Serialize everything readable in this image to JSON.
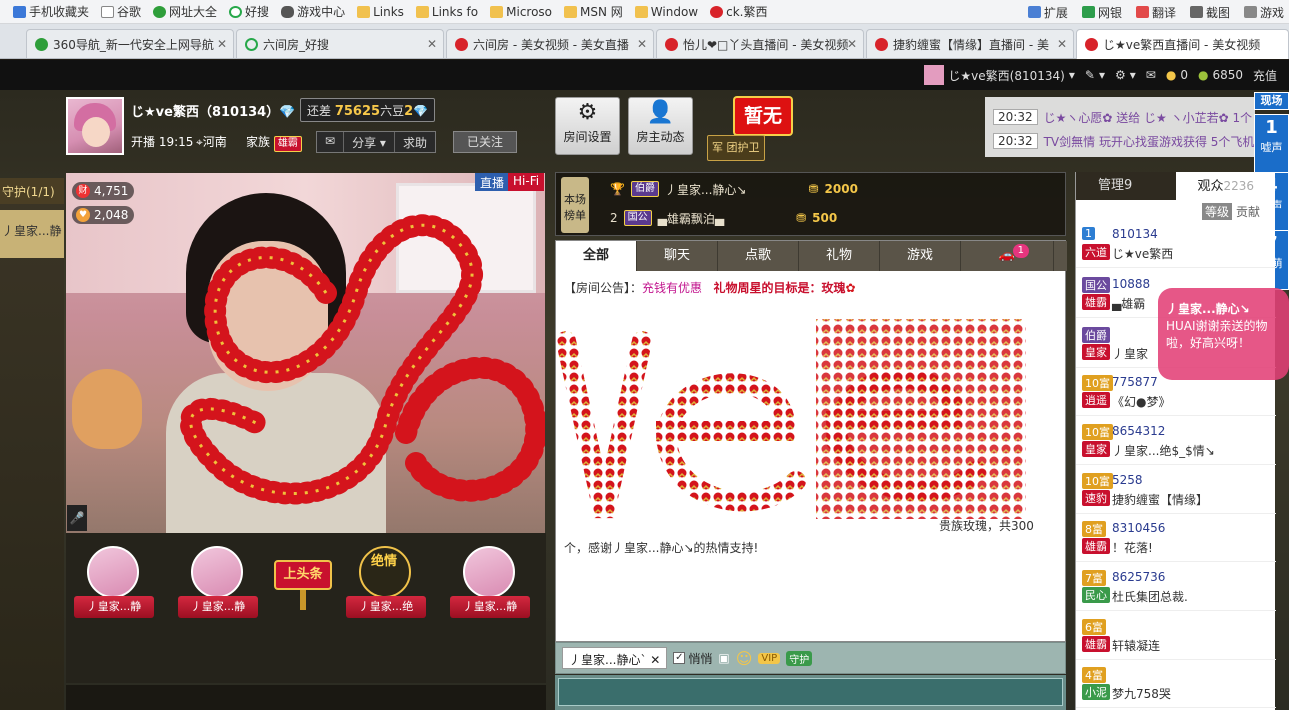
{
  "bookmarks": {
    "items": [
      {
        "label": "手机收藏夹",
        "icon": "phone-icon"
      },
      {
        "label": "谷歌",
        "icon": "page-icon"
      },
      {
        "label": "网址大全",
        "icon": "portal-icon"
      },
      {
        "label": "好搜",
        "icon": "search-icon"
      },
      {
        "label": "游戏中心",
        "icon": "game-icon"
      },
      {
        "label": "Links",
        "icon": "folder-icon"
      },
      {
        "label": "Links fo",
        "icon": "folder-icon"
      },
      {
        "label": "Microso",
        "icon": "folder-icon"
      },
      {
        "label": "MSN 网",
        "icon": "folder-icon"
      },
      {
        "label": "Window",
        "icon": "folder-icon"
      },
      {
        "label": "ck.繁西",
        "icon": "six-room-icon"
      }
    ],
    "right": [
      "扩展",
      "网银",
      "翻译",
      "截图",
      "游戏"
    ]
  },
  "tabs": [
    {
      "label": "360导航_新一代安全上网导航"
    },
    {
      "label": "六间房_好搜"
    },
    {
      "label": "六间房 - 美女视频 - 美女直播"
    },
    {
      "label": "怡儿❤□丫头直播间 - 美女视频"
    },
    {
      "label": "捷豹缠蜜【情缘】直播间 - 美"
    },
    {
      "label": "じ★ve繁西直播间 - 美女视频"
    }
  ],
  "topbar": {
    "user": "じ★ve繁西(810134)",
    "coins": "0",
    "beans": "6850",
    "recharge": "充值"
  },
  "host": {
    "name": "じ★ve繁西（810134）",
    "diff_prefix": "还差",
    "diff_value": "75625",
    "diff_unit": "六豆",
    "diff_level": "2",
    "live_time": "开播 19:15",
    "location": "河南",
    "family": "家族",
    "family_badge": "雄霸",
    "share": "分享",
    "request": "求助",
    "followed": "已关注"
  },
  "left": {
    "guard_tab": "守护(1/1)",
    "guard_item": "丿皇家...静"
  },
  "video": {
    "live": "直播",
    "hifi": "Hi-Fi",
    "stat_wealth": "4,751",
    "stat_fans": "2,048"
  },
  "seats": [
    "丿皇家...静",
    "丿皇家...静",
    "丿皇家...绝",
    "丿皇家...静"
  ],
  "headline": "上头条",
  "jueqing": "绝情",
  "tools": {
    "room_settings": "房间设置",
    "host_feed": "房主动态",
    "zanwu": "暂无",
    "guard": "团护卫",
    "guard_mark": "军"
  },
  "rank": {
    "label": "本场榜单",
    "rows": [
      {
        "pos": "1",
        "title": "伯爵",
        "name": "丿皇家...静心↘",
        "amount": "2000"
      },
      {
        "pos": "2",
        "title": "国公",
        "name": "▄雄霸飘泊▄",
        "amount": "500"
      }
    ]
  },
  "chat": {
    "tabs": [
      "全部",
      "聊天",
      "点歌",
      "礼物",
      "游戏"
    ],
    "car_count": "1",
    "notice_label": "【房间公告】：",
    "notice_pk": "充钱有优惠",
    "notice_star": "礼物周星的目标是：玫瑰",
    "gift_msg_a": "贵族玫瑰，共300",
    "gift_msg_b": "个，感谢丿皇家...静心↘的热情支持!",
    "input_target": "丿皇家...静心`",
    "whisper": "悄悄"
  },
  "tickers": [
    {
      "time": "20:32",
      "text": "じ★ヽ心愿✿ 送给 じ★ ヽ小芷若✿ 1个"
    },
    {
      "time": "20:32",
      "text": "TV剑無情 玩开心找蛋游戏获得 5个飞机"
    }
  ],
  "side_buttons": [
    {
      "title": "现场"
    },
    {
      "num": "1",
      "label": "嘘声"
    },
    {
      "num": "4",
      "label": "笑声"
    },
    {
      "num": "7",
      "label": "卖萌"
    }
  ],
  "right": {
    "tab_admin": "管理9",
    "tab_audience": "观众",
    "audience_count": "2236",
    "sub_level": "等级",
    "sub_contrib": "贡献",
    "users": [
      {
        "tag": "1",
        "tag2": "六道",
        "uid": "810134",
        "nick": "じ★ve繁西"
      },
      {
        "tag": "国公",
        "tag2": "雄霸",
        "uid": "10888",
        "nick": "▄雄霸"
      },
      {
        "tag": "伯爵",
        "tag2": "皇家",
        "uid": "",
        "nick": "丿皇家"
      },
      {
        "tag": "10富",
        "tag2": "逍遥",
        "uid": "775877",
        "nick": "《幻●梦》"
      },
      {
        "tag": "10富",
        "tag2": "皇家",
        "uid": "8654312",
        "nick": "丿皇家...绝$_$情↘"
      },
      {
        "tag": "10富",
        "tag2": "速豹",
        "uid": "5258",
        "nick": "捷豹缠蜜【情缘】"
      },
      {
        "tag": "8富",
        "tag2": "雄霸",
        "uid": "8310456",
        "nick": "！花落!"
      },
      {
        "tag": "7富",
        "tag2": "民心",
        "uid": "8625736",
        "nick": "杜氏集团总裁."
      },
      {
        "tag": "6富",
        "tag2": "雄霸",
        "uid": "",
        "nick": "轩辕凝连"
      },
      {
        "tag": "4富",
        "tag2": "小泥",
        "uid": "",
        "nick": "梦九758哭"
      }
    ]
  },
  "bubble": {
    "name": "丿皇家...静心↘",
    "text": "HUAI谢谢亲送的物啦，好高兴呀！"
  }
}
